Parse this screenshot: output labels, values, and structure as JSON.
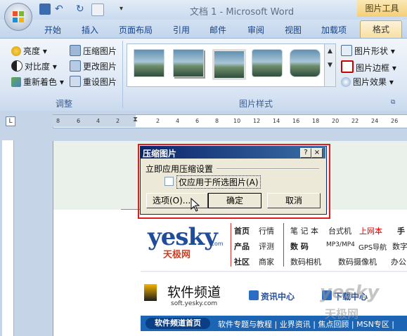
{
  "window": {
    "title": "文档 1 - Microsoft Word",
    "contextual_tab_group": "图片工具"
  },
  "tabs": [
    "开始",
    "插入",
    "页面布局",
    "引用",
    "邮件",
    "审阅",
    "视图",
    "加载项"
  ],
  "active_tab": "格式",
  "ribbon": {
    "adjust": {
      "label": "调整",
      "brightness": "亮度",
      "contrast": "对比度",
      "recolor": "重新着色",
      "compress": "压缩图片",
      "change": "更改图片",
      "reset": "重设图片"
    },
    "styles": {
      "label": "图片样式",
      "shape": "图片形状",
      "border": "图片边框",
      "effects": "图片效果"
    }
  },
  "ruler_ticks": [
    "8",
    "6",
    "4",
    "2",
    "2",
    "4",
    "6",
    "8",
    "10",
    "12",
    "14",
    "16",
    "18",
    "20",
    "22",
    "24",
    "26"
  ],
  "dialog": {
    "title": "压缩图片",
    "help": "?",
    "close": "×",
    "section": "立即应用压缩设置",
    "checkbox_label": "仅应用于所选图片(A)",
    "checkbox_checked": false,
    "options_btn": "选项(O)...",
    "ok_btn": "确定",
    "cancel_btn": "取消"
  },
  "web": {
    "logo": "yesky",
    "logo_com": ".com",
    "logo_cn": "天极网",
    "nav_rows": [
      [
        "首页",
        "行情",
        "笔 记 本",
        "台式机",
        "上网本",
        "手"
      ],
      [
        "产品",
        "评测",
        "数 码",
        "MP3/MP4",
        "GPS导航",
        "数字"
      ],
      [
        "社区",
        "商家",
        "数码相机",
        "数码摄像机",
        "办公"
      ]
    ],
    "channel_title": "软件频道",
    "channel_url": "soft.yesky.com",
    "channel_links": [
      "资讯中心",
      "下载中心"
    ],
    "nav_home": "软件频道首页",
    "nav_items": "软件专题与教程 | 业界资讯 | 焦点回顾 | MSN专区 |",
    "watermark": "yesky",
    "watermark2": "天极网"
  }
}
